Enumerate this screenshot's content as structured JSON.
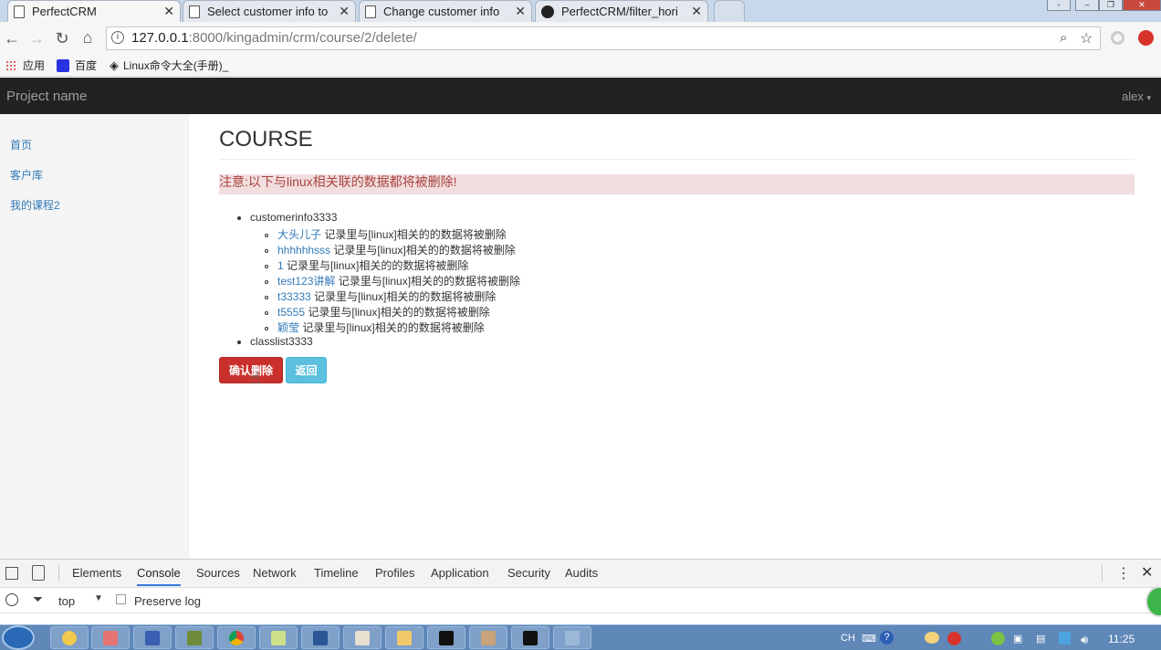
{
  "browser": {
    "tabs": [
      {
        "title": "PerfectCRM",
        "active": true
      },
      {
        "title": "Select customer info to",
        "active": false
      },
      {
        "title": "Change customer info",
        "active": false
      },
      {
        "title": "PerfectCRM/filter_hori",
        "active": false
      }
    ],
    "url_host": "127.0.0.1",
    "url_rest": ":8000/kingadmin/crm/course/2/delete/",
    "bookmarks": [
      "应用",
      "百度",
      "Linux命令大全(手册)_"
    ]
  },
  "app": {
    "brand": "Project name",
    "user": "alex"
  },
  "sidebar": {
    "items": [
      "首页",
      "客户库",
      "我的课程2"
    ]
  },
  "main": {
    "title": "COURSE",
    "alert": "注意:以下与linux相关联的数据都将被删除!",
    "groups": [
      {
        "name": "customerinfo3333",
        "items": [
          {
            "link": "大头儿子",
            "text": " 记录里与[linux]相关的的数据将被删除"
          },
          {
            "link": "hhhhhhsss",
            "text": " 记录里与[linux]相关的的数据将被删除"
          },
          {
            "link": "1",
            "text": " 记录里与[linux]相关的的数据将被删除"
          },
          {
            "link": "test123讲解",
            "text": " 记录里与[linux]相关的的数据将被删除"
          },
          {
            "link": "t33333",
            "text": " 记录里与[linux]相关的的数据将被删除"
          },
          {
            "link": "t5555",
            "text": " 记录里与[linux]相关的的数据将被删除"
          },
          {
            "link": "颖莹",
            "text": " 记录里与[linux]相关的的数据将被删除"
          }
        ]
      },
      {
        "name": "classlist3333",
        "items": []
      }
    ],
    "confirm_label": "确认删除",
    "back_label": "返回"
  },
  "devtools": {
    "tabs": [
      "Elements",
      "Console",
      "Sources",
      "Network",
      "Timeline",
      "Profiles",
      "Application",
      "Security",
      "Audits"
    ],
    "active_tab": "Console",
    "context": "top",
    "preserve_log": "Preserve log"
  },
  "taskbar": {
    "lang": "CH",
    "clock": "11:25"
  }
}
